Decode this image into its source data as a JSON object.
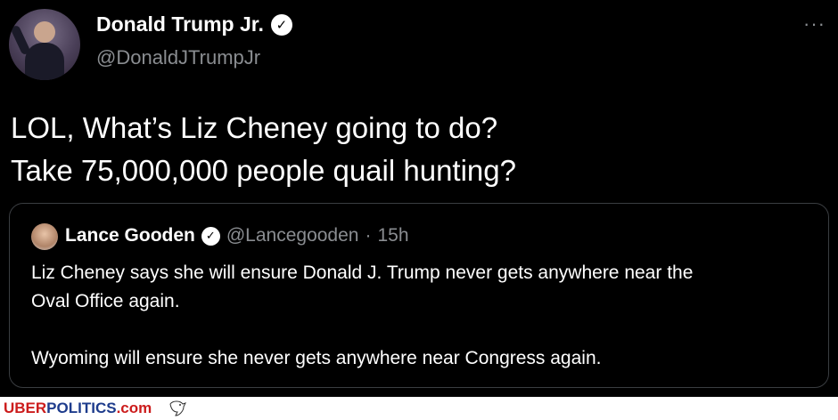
{
  "tweet": {
    "author_name": "Donald Trump Jr.",
    "author_handle": "@DonaldJTrumpJr",
    "more_icon": "more-dots-icon",
    "text_line1": "LOL, What’s Liz Cheney going to do?",
    "text_line2": "Take 75,000,000 people quail hunting?"
  },
  "quote": {
    "author_name": "Lance Gooden",
    "author_handle": "@Lancegooden",
    "separator": "·",
    "time": "15h",
    "text": "Liz Cheney says she will ensure Donald J. Trump never gets anywhere near the\nOval Office again.\n\nWyoming will ensure she never gets anywhere near Congress again."
  },
  "watermark": {
    "part1": "UBER",
    "part2": "POLITICS",
    "part3": ".com"
  },
  "colors": {
    "background": "#000000",
    "brand_red": "#cc1c1c",
    "brand_blue": "#1e3c8c"
  }
}
